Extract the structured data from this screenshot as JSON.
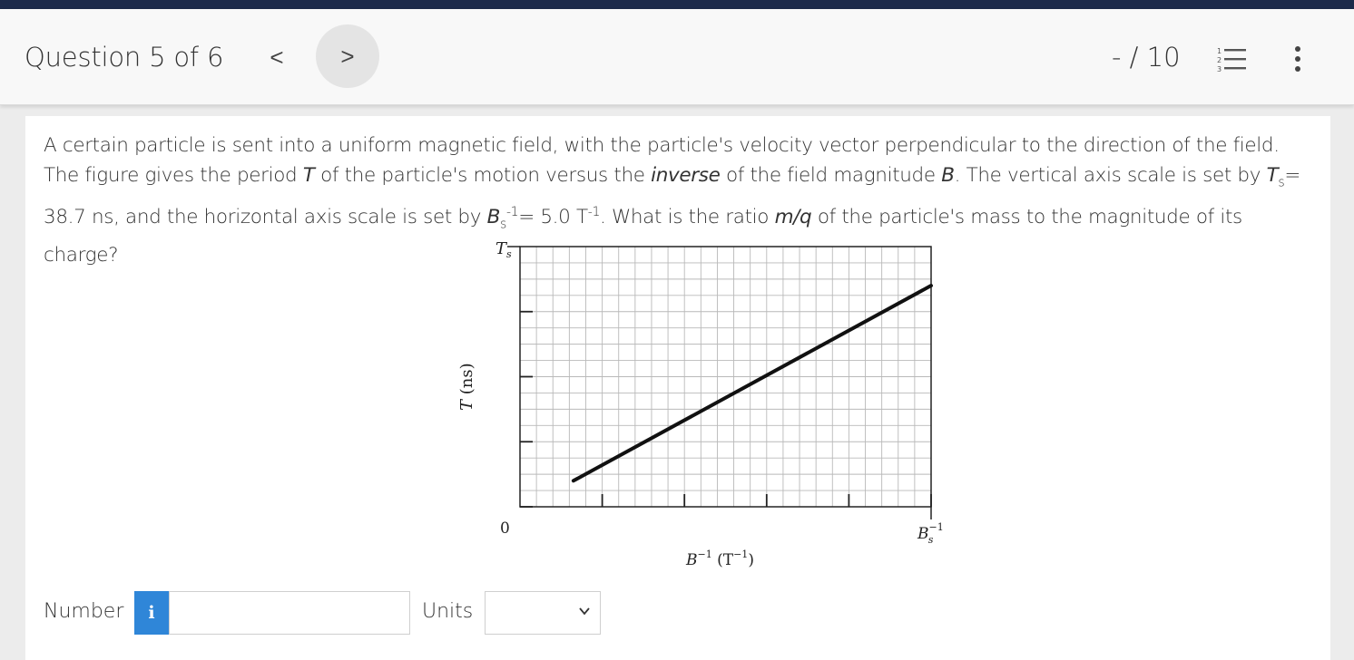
{
  "header": {
    "question_label": "Question 5 of 6",
    "prev_symbol": "<",
    "next_symbol": ">",
    "score": "- / 10"
  },
  "question": {
    "text_parts": {
      "p1": "A certain particle is sent into a uniform magnetic field, with the particle's velocity vector perpendicular to the direction of the field. The figure gives the period ",
      "T": "T",
      "p2": " of the particle's motion versus the ",
      "inverse": "inverse",
      "p3": " of the field magnitude ",
      "B": "B",
      "p4": ". The vertical axis scale is set by ",
      "Ts_T": "T",
      "Ts_sub": "s",
      "p5": "= 38.7 ns, and the horizontal axis scale is set by ",
      "Bs_B": "B",
      "Bs_sub": "s",
      "Bs_sup": "-1",
      "p6": "= 5.0 T",
      "T_sup": "-1",
      "p7": ". What is the ratio ",
      "mq": "m/q",
      "p8": " of the particle's mass to the magnitude of its charge?"
    }
  },
  "figure": {
    "y_top_label": "Ts",
    "y_axis_label": "T (ns)",
    "origin_label": "0",
    "x_end_label": "Bs-1",
    "x_axis_label": "B-1 (T-1)"
  },
  "chart_data": {
    "type": "line",
    "title": "",
    "xlabel": "B⁻¹ (T⁻¹)",
    "ylabel": "T (ns)",
    "x_scale_label": "B_s⁻¹",
    "y_scale_label": "T_s",
    "xlim": [
      0,
      1
    ],
    "ylim": [
      0,
      1
    ],
    "grid": true,
    "series": [
      {
        "x": [
          0.13,
          1.0
        ],
        "y": [
          0.1,
          0.85
        ]
      }
    ]
  },
  "answer": {
    "number_label": "Number",
    "info_symbol": "i",
    "number_value": "",
    "units_label": "Units",
    "units_value": ""
  }
}
